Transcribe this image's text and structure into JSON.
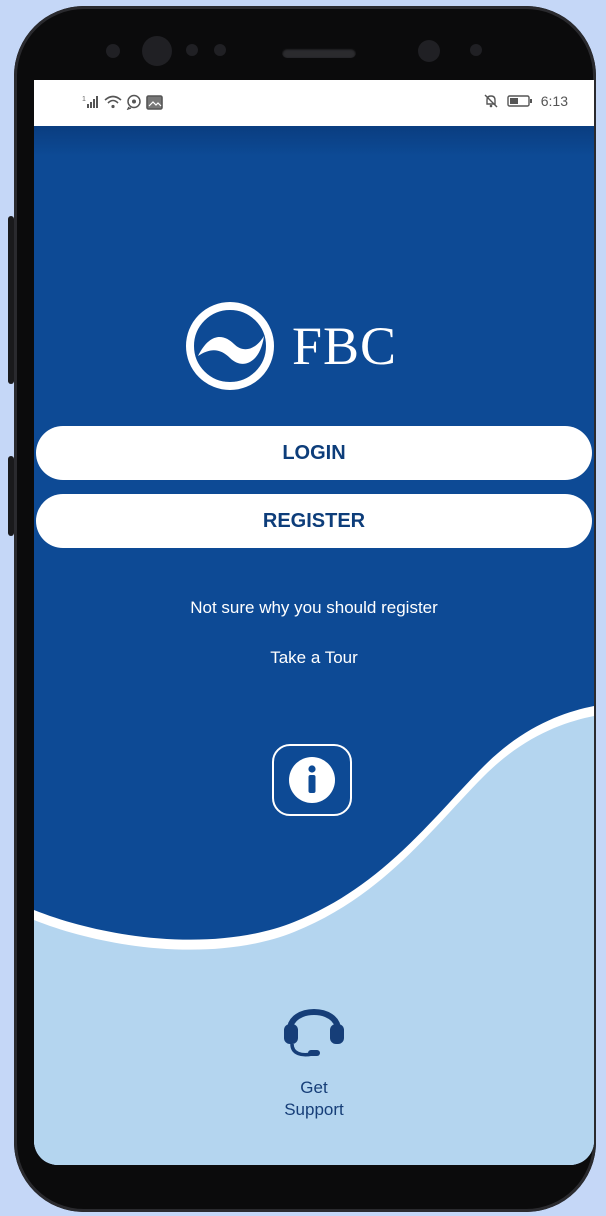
{
  "status_bar": {
    "time": "6:13",
    "left_icons": [
      "signal-icon",
      "wifi-icon",
      "whatsapp-icon",
      "gallery-icon"
    ],
    "right_icons": [
      "mute-icon",
      "battery-icon"
    ]
  },
  "brand": {
    "name": "FBC"
  },
  "actions": {
    "login_label": "LOGIN",
    "register_label": "REGISTER"
  },
  "tour": {
    "prompt": "Not sure why you should register",
    "link": "Take a Tour",
    "icon": "info-icon"
  },
  "support": {
    "line1": "Get",
    "line2": "Support",
    "icon": "headset-icon"
  },
  "colors": {
    "primary_blue": "#0d4a95",
    "light_blue": "#b4d5ef",
    "button_text": "#0d3d7a",
    "support_text": "#163e78",
    "page_background": "#c5d7f7"
  }
}
